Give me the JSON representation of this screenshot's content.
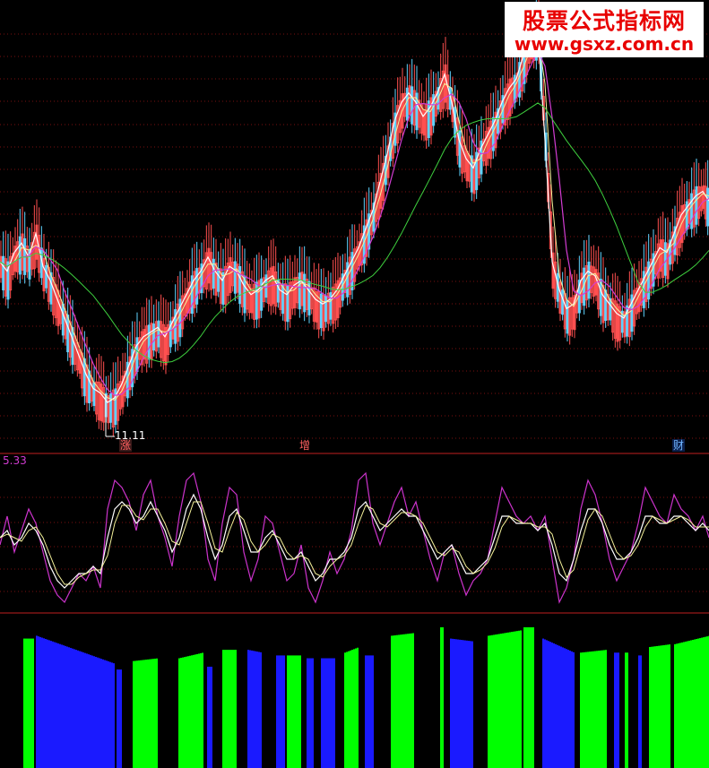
{
  "watermark": {
    "line1": "股票公式指标网",
    "line2": "www.gsxz.com.cn"
  },
  "low_marker": "11.11",
  "osc_value": "5.33",
  "event_tags": [
    {
      "text": "涨",
      "color": "#ff6060",
      "bg": "#3a1a1a"
    },
    {
      "text": "增",
      "color": "#ff6060",
      "bg": "#000000"
    },
    {
      "text": "财",
      "color": "#6fb4ff",
      "bg": "#0b1f4a"
    }
  ],
  "colors": {
    "grid": "#7a1010",
    "separator": "#c02020",
    "ma_white": "#ffffff",
    "ma_yellow": "#f5f29a",
    "ma_magenta": "#d23cd2",
    "ma_green": "#3ecf3e",
    "candle_up": "#ff5050",
    "candle_down": "#5fd3ff",
    "osc_fast": "#cc33cc",
    "osc_mid": "#ffffff",
    "osc_slow": "#f5f29a",
    "bar_green": "#00ff00",
    "bar_blue": "#1a1aff"
  },
  "chart_data": {
    "type": "line",
    "panels": [
      {
        "name": "price",
        "x": [
          0,
          8,
          16,
          24,
          32,
          40,
          48,
          56,
          64,
          72,
          80,
          88,
          96,
          104,
          112,
          120,
          128,
          136,
          144,
          152,
          160,
          168,
          176,
          184,
          192,
          200,
          208,
          216,
          224,
          232,
          240,
          248,
          256,
          264,
          272,
          280,
          288,
          296,
          304,
          312,
          320,
          328,
          336,
          344,
          352,
          360,
          368,
          376,
          384,
          392,
          400,
          408,
          416,
          424,
          432,
          440,
          448,
          456,
          464,
          472,
          480,
          488,
          496,
          504,
          512,
          520,
          528,
          536,
          544,
          552,
          560,
          568,
          576,
          584,
          592,
          600,
          608,
          616,
          624,
          632,
          640,
          648,
          656,
          664,
          672,
          680,
          688,
          696,
          704,
          712,
          720,
          728,
          736,
          744,
          752,
          760,
          768,
          776,
          784,
          791
        ],
        "close": [
          14.2,
          14.0,
          14.4,
          14.6,
          14.3,
          14.8,
          14.1,
          13.8,
          13.4,
          13.0,
          12.6,
          12.2,
          11.8,
          11.5,
          11.4,
          11.2,
          11.3,
          11.6,
          12.0,
          12.4,
          12.6,
          12.7,
          12.8,
          12.6,
          12.9,
          13.2,
          13.5,
          13.8,
          14.0,
          14.3,
          14.0,
          13.8,
          14.1,
          14.0,
          13.7,
          13.5,
          13.6,
          13.8,
          13.9,
          13.6,
          13.5,
          13.7,
          13.8,
          13.6,
          13.4,
          13.3,
          13.4,
          13.6,
          13.9,
          14.2,
          14.5,
          14.9,
          15.3,
          15.9,
          16.5,
          17.2,
          17.6,
          17.8,
          17.6,
          17.3,
          17.5,
          17.8,
          18.2,
          17.6,
          16.8,
          16.4,
          16.2,
          16.6,
          16.9,
          17.2,
          17.6,
          17.9,
          18.1,
          18.6,
          18.9,
          19.2,
          16.8,
          14.2,
          13.6,
          13.2,
          13.3,
          13.8,
          14.0,
          13.9,
          13.5,
          13.3,
          13.1,
          13.0,
          13.3,
          13.6,
          13.9,
          14.2,
          14.5,
          14.4,
          14.8,
          15.2,
          15.4,
          15.6,
          15.7,
          15.5
        ],
        "ylim": [
          10.8,
          19.4
        ]
      },
      {
        "name": "oscillator",
        "fast": [
          -1,
          3,
          -2,
          1,
          4,
          2,
          -2,
          -6,
          -8,
          -9,
          -7,
          -5,
          -6,
          -4,
          -7,
          4,
          8,
          7,
          5,
          1,
          6,
          8,
          3,
          0,
          -4,
          3,
          8,
          9,
          5,
          -3,
          -6,
          2,
          7,
          6,
          -2,
          -6,
          -3,
          3,
          2,
          -2,
          -6,
          -5,
          -1,
          -7,
          -9,
          -6,
          -2,
          -5,
          -3,
          1,
          8,
          9,
          2,
          -1,
          2,
          5,
          7,
          3,
          5,
          1,
          -3,
          -6,
          -2,
          -1,
          -5,
          -8,
          -6,
          -5,
          -3,
          2,
          7,
          5,
          3,
          2,
          3,
          1,
          3,
          -3,
          -9,
          -7,
          -3,
          4,
          8,
          6,
          2,
          -3,
          -6,
          -4,
          -2,
          2,
          7,
          5,
          3,
          2,
          6,
          4,
          3,
          1,
          3,
          0
        ],
        "mid": [
          0,
          1,
          -1,
          0,
          2,
          1,
          -1,
          -4,
          -6,
          -7,
          -6,
          -5,
          -5,
          -4,
          -5,
          0,
          4,
          5,
          4,
          2,
          3,
          5,
          3,
          1,
          -2,
          0,
          4,
          6,
          4,
          0,
          -3,
          -1,
          3,
          4,
          1,
          -2,
          -2,
          0,
          1,
          -1,
          -3,
          -3,
          -2,
          -4,
          -6,
          -5,
          -3,
          -3,
          -2,
          0,
          4,
          5,
          3,
          1,
          2,
          3,
          4,
          3,
          3,
          1,
          -1,
          -3,
          -2,
          -1,
          -3,
          -5,
          -5,
          -4,
          -3,
          0,
          3,
          3,
          2,
          2,
          2,
          1,
          2,
          -1,
          -5,
          -6,
          -3,
          1,
          4,
          4,
          2,
          -1,
          -3,
          -3,
          -2,
          0,
          3,
          3,
          2,
          2,
          3,
          3,
          2,
          1,
          2,
          1
        ],
        "ylim": [
          -10,
          10
        ]
      },
      {
        "name": "histogram",
        "groups": [
          {
            "x1": 26,
            "x2": 38,
            "color": "green",
            "v0": 0.92,
            "v1": 0.92
          },
          {
            "x1": 40,
            "x2": 128,
            "color": "blue",
            "v0": 0.94,
            "v1": 0.74
          },
          {
            "x1": 130,
            "x2": 136,
            "color": "blue",
            "v0": 0.7,
            "v1": 0.7
          },
          {
            "x1": 148,
            "x2": 176,
            "color": "green",
            "v0": 0.76,
            "v1": 0.78
          },
          {
            "x1": 199,
            "x2": 226,
            "color": "green",
            "v0": 0.78,
            "v1": 0.82
          },
          {
            "x1": 231,
            "x2": 236,
            "color": "blue",
            "v0": 0.72,
            "v1": 0.72
          },
          {
            "x1": 248,
            "x2": 264,
            "color": "green",
            "v0": 0.84,
            "v1": 0.84
          },
          {
            "x1": 276,
            "x2": 292,
            "color": "blue",
            "v0": 0.84,
            "v1": 0.82
          },
          {
            "x1": 308,
            "x2": 318,
            "color": "blue",
            "v0": 0.8,
            "v1": 0.8
          },
          {
            "x1": 320,
            "x2": 336,
            "color": "green",
            "v0": 0.8,
            "v1": 0.8
          },
          {
            "x1": 342,
            "x2": 350,
            "color": "blue",
            "v0": 0.78,
            "v1": 0.78
          },
          {
            "x1": 358,
            "x2": 374,
            "color": "blue",
            "v0": 0.78,
            "v1": 0.78
          },
          {
            "x1": 384,
            "x2": 400,
            "color": "green",
            "v0": 0.82,
            "v1": 0.86
          },
          {
            "x1": 407,
            "x2": 416,
            "color": "blue",
            "v0": 0.8,
            "v1": 0.8
          },
          {
            "x1": 436,
            "x2": 462,
            "color": "green",
            "v0": 0.94,
            "v1": 0.96
          },
          {
            "x1": 491,
            "x2": 495,
            "color": "green",
            "v0": 1.0,
            "v1": 1.0
          },
          {
            "x1": 502,
            "x2": 527,
            "color": "blue",
            "v0": 0.92,
            "v1": 0.9
          },
          {
            "x1": 544,
            "x2": 582,
            "color": "green",
            "v0": 0.94,
            "v1": 0.98
          },
          {
            "x1": 584,
            "x2": 596,
            "color": "green",
            "v0": 1.0,
            "v1": 1.0
          },
          {
            "x1": 605,
            "x2": 640,
            "color": "blue",
            "v0": 0.92,
            "v1": 0.82
          },
          {
            "x1": 647,
            "x2": 676,
            "color": "green",
            "v0": 0.82,
            "v1": 0.84
          },
          {
            "x1": 685,
            "x2": 690,
            "color": "blue",
            "v0": 0.82,
            "v1": 0.82
          },
          {
            "x1": 697,
            "x2": 700,
            "color": "green",
            "v0": 0.82,
            "v1": 0.82
          },
          {
            "x1": 712,
            "x2": 716,
            "color": "blue",
            "v0": 0.8,
            "v1": 0.8
          },
          {
            "x1": 724,
            "x2": 748,
            "color": "green",
            "v0": 0.86,
            "v1": 0.88
          },
          {
            "x1": 752,
            "x2": 791,
            "color": "green",
            "v0": 0.88,
            "v1": 0.94
          }
        ]
      }
    ]
  }
}
